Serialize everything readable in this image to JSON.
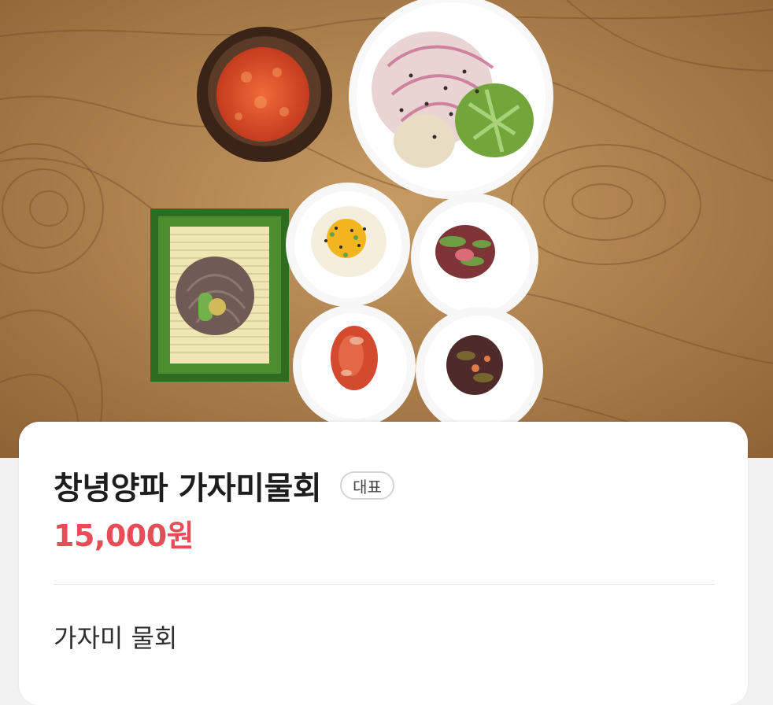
{
  "menu_item": {
    "photo_description_icon": "food-photo-icon",
    "name": "창녕양파 가자미물회",
    "badge": "대표",
    "price": "15,000원",
    "description": "가자미 물회"
  },
  "colors": {
    "price": "#e84d57",
    "card_background": "#ffffff",
    "table_wood": "#b98a53"
  }
}
